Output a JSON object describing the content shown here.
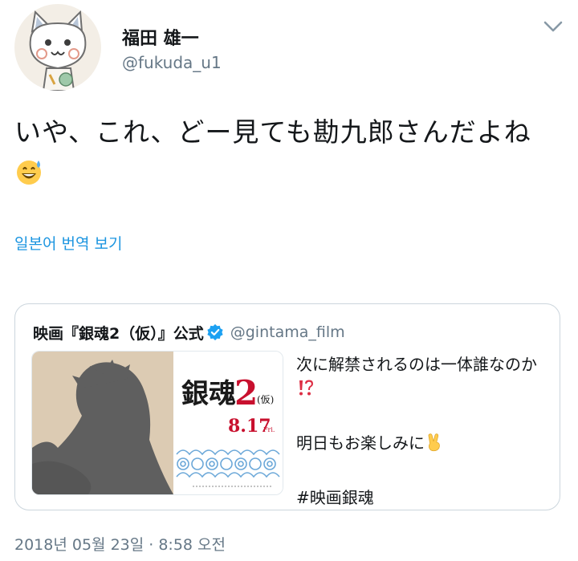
{
  "author": {
    "name": "福田 雄一",
    "handle": "@fukuda_u1",
    "avatar_icon": "cat-doodle-avatar"
  },
  "tweet": {
    "text": "いや、これ、どー見ても勘九郎さんだよね",
    "emoji_icon": "grinning-sweat-emoji"
  },
  "translate": {
    "label": "일본어 번역 보기"
  },
  "quote": {
    "name": "映画『銀魂2（仮）』公式",
    "handle": "@gintama_film",
    "verified": true,
    "lines": {
      "l1": "次に解禁されるのは一体誰なのか",
      "l2": "明日もお楽しみに",
      "l3": "#映画銀魂"
    },
    "media": {
      "title_big": "銀魂",
      "title_num": "2",
      "title_sub": "(仮)",
      "date": "8.17",
      "day": "Fri."
    }
  },
  "meta": {
    "timestamp": "2018년 05월 23일 · 8:58 오전"
  },
  "colors": {
    "link": "#1b95e0",
    "secondary": "#657786",
    "border": "#ccd6dd",
    "accent_red": "#c8102e"
  }
}
